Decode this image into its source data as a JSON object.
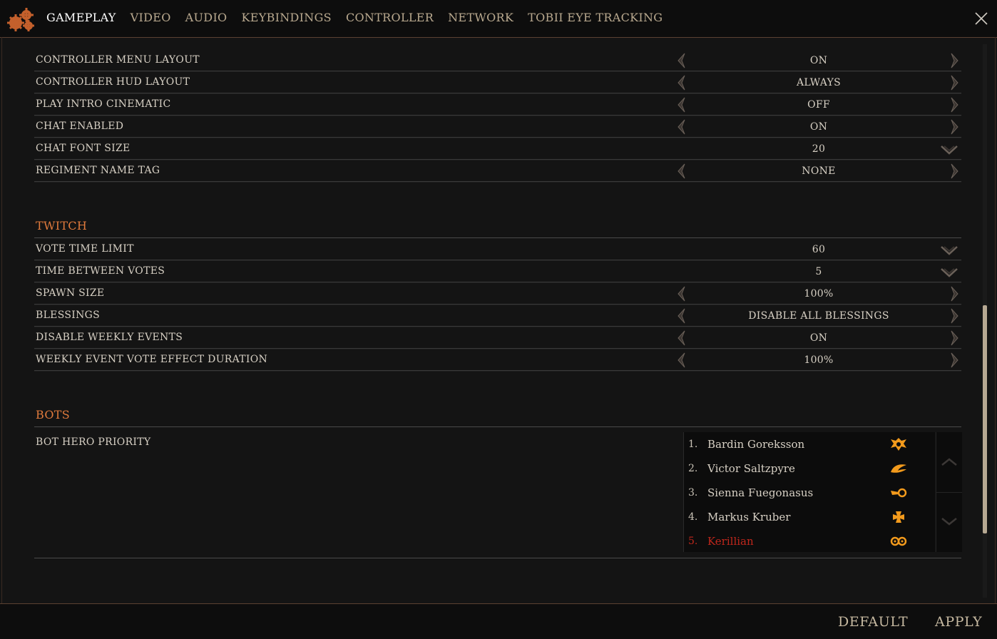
{
  "tabs": [
    "GAMEPLAY",
    "VIDEO",
    "AUDIO",
    "KEYBINDINGS",
    "CONTROLLER",
    "NETWORK",
    "TOBII EYE TRACKING"
  ],
  "active_tab": "GAMEPLAY",
  "settings": [
    {
      "label": "CONTROLLER MENU LAYOUT",
      "value": "ON",
      "control": "arrows"
    },
    {
      "label": "CONTROLLER HUD LAYOUT",
      "value": "ALWAYS",
      "control": "arrows"
    },
    {
      "label": "PLAY INTRO CINEMATIC",
      "value": "OFF",
      "control": "arrows"
    },
    {
      "label": "CHAT ENABLED",
      "value": "ON",
      "control": "arrows"
    },
    {
      "label": "CHAT FONT SIZE",
      "value": "20",
      "control": "dropdown"
    },
    {
      "label": "REGIMENT NAME TAG",
      "value": "NONE",
      "control": "arrows"
    }
  ],
  "twitch": {
    "heading": "TWITCH",
    "settings": [
      {
        "label": "VOTE TIME LIMIT",
        "value": "60",
        "control": "dropdown"
      },
      {
        "label": "TIME BETWEEN VOTES",
        "value": "5",
        "control": "dropdown"
      },
      {
        "label": "SPAWN SIZE",
        "value": "100%",
        "control": "arrows"
      },
      {
        "label": "BLESSINGS",
        "value": "DISABLE ALL BLESSINGS",
        "control": "arrows"
      },
      {
        "label": "DISABLE WEEKLY EVENTS",
        "value": "ON",
        "control": "arrows"
      },
      {
        "label": "WEEKLY EVENT VOTE EFFECT DURATION",
        "value": "100%",
        "control": "arrows"
      }
    ]
  },
  "bots": {
    "heading": "BOTS",
    "label": "BOT HERO PRIORITY",
    "list": [
      {
        "num": "1.",
        "name": "Bardin Goreksson",
        "emblem": "dwarf-emblem-icon"
      },
      {
        "num": "2.",
        "name": "Victor Saltzpyre",
        "emblem": "witch-hunter-emblem-icon"
      },
      {
        "num": "3.",
        "name": "Sienna Fuegonasus",
        "emblem": "fire-emblem-icon"
      },
      {
        "num": "4.",
        "name": "Markus Kruber",
        "emblem": "cross-emblem-icon"
      },
      {
        "num": "5.",
        "name": "Kerillian",
        "emblem": "elf-emblem-icon"
      }
    ],
    "selected_index": 4
  },
  "buttons": {
    "default": "DEFAULT",
    "apply": "APPLY"
  },
  "colors": {
    "accent": "#e07a3c",
    "selected": "#c0271c",
    "emblem": "#f29a1c",
    "text": "#d7d0c4"
  }
}
